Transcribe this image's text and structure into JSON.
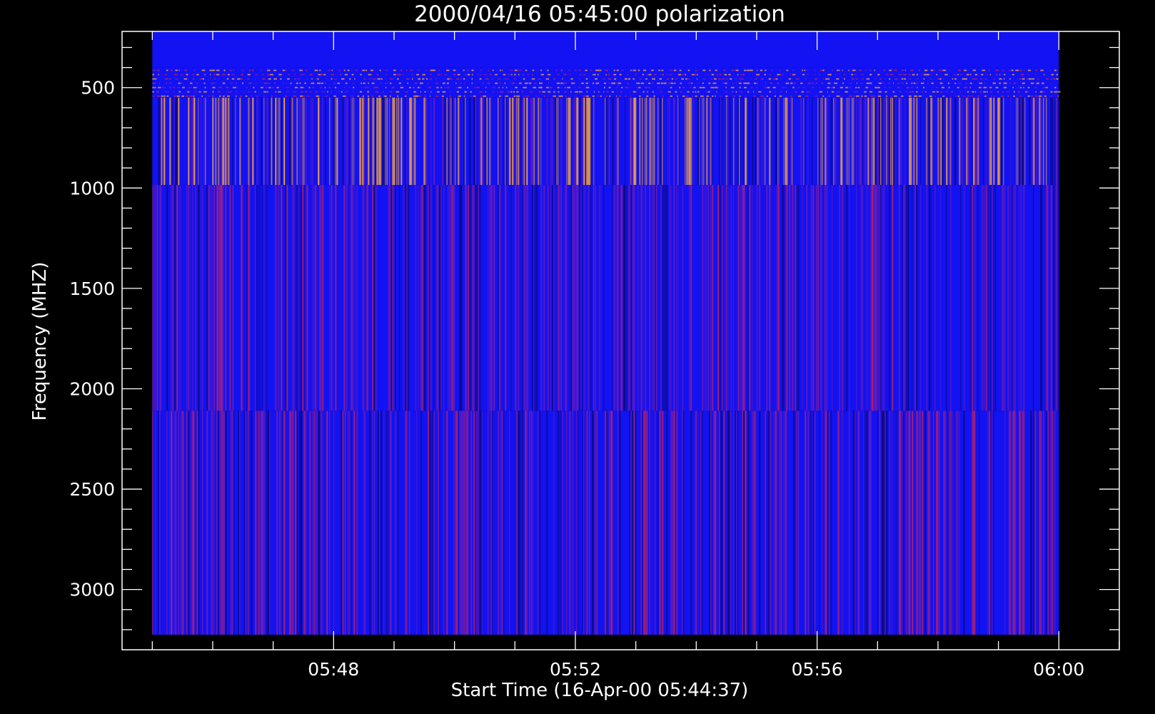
{
  "chart_data": {
    "type": "heatmap",
    "title": "2000/04/16 05:45:00 polarization",
    "xlabel": "Start Time (16-Apr-00 05:44:37)",
    "ylabel": "Frequency (MHZ)",
    "x_ticks": [
      {
        "label": "05:48",
        "minutes": 48
      },
      {
        "label": "05:52",
        "minutes": 52
      },
      {
        "label": "05:56",
        "minutes": 56
      },
      {
        "label": "06:00",
        "minutes": 60
      }
    ],
    "x_range_minutes": [
      44.5,
      61.0
    ],
    "y_ticks": [
      500,
      1000,
      1500,
      2000,
      2500,
      3000
    ],
    "ylim": [
      3300,
      220
    ],
    "y_inverted": true,
    "data_extent": {
      "time_minutes": [
        45.0,
        60.0
      ],
      "frequency_mhz": [
        220,
        3225
      ]
    },
    "frequency_bands": [
      {
        "from_mhz": 220,
        "to_mhz": 400,
        "pattern": "uniform-blue"
      },
      {
        "from_mhz": 400,
        "to_mhz": 550,
        "pattern": "dotted-horizontal-stripes"
      },
      {
        "from_mhz": 550,
        "to_mhz": 985,
        "pattern": "orange-vertical-streaks"
      },
      {
        "from_mhz": 985,
        "to_mhz": 2110,
        "pattern": "purple-vertical-streaks"
      },
      {
        "from_mhz": 2110,
        "to_mhz": 3225,
        "pattern": "red-vertical-streaks"
      }
    ],
    "colors": {
      "background": "#000000",
      "base": "#1212f2",
      "dark": "#0a0a7a",
      "purple": "#6a1cb8",
      "red": "#b0206a",
      "orange": "#f0a040",
      "axis": "#ffffff"
    },
    "grid": false,
    "legend": "none"
  }
}
